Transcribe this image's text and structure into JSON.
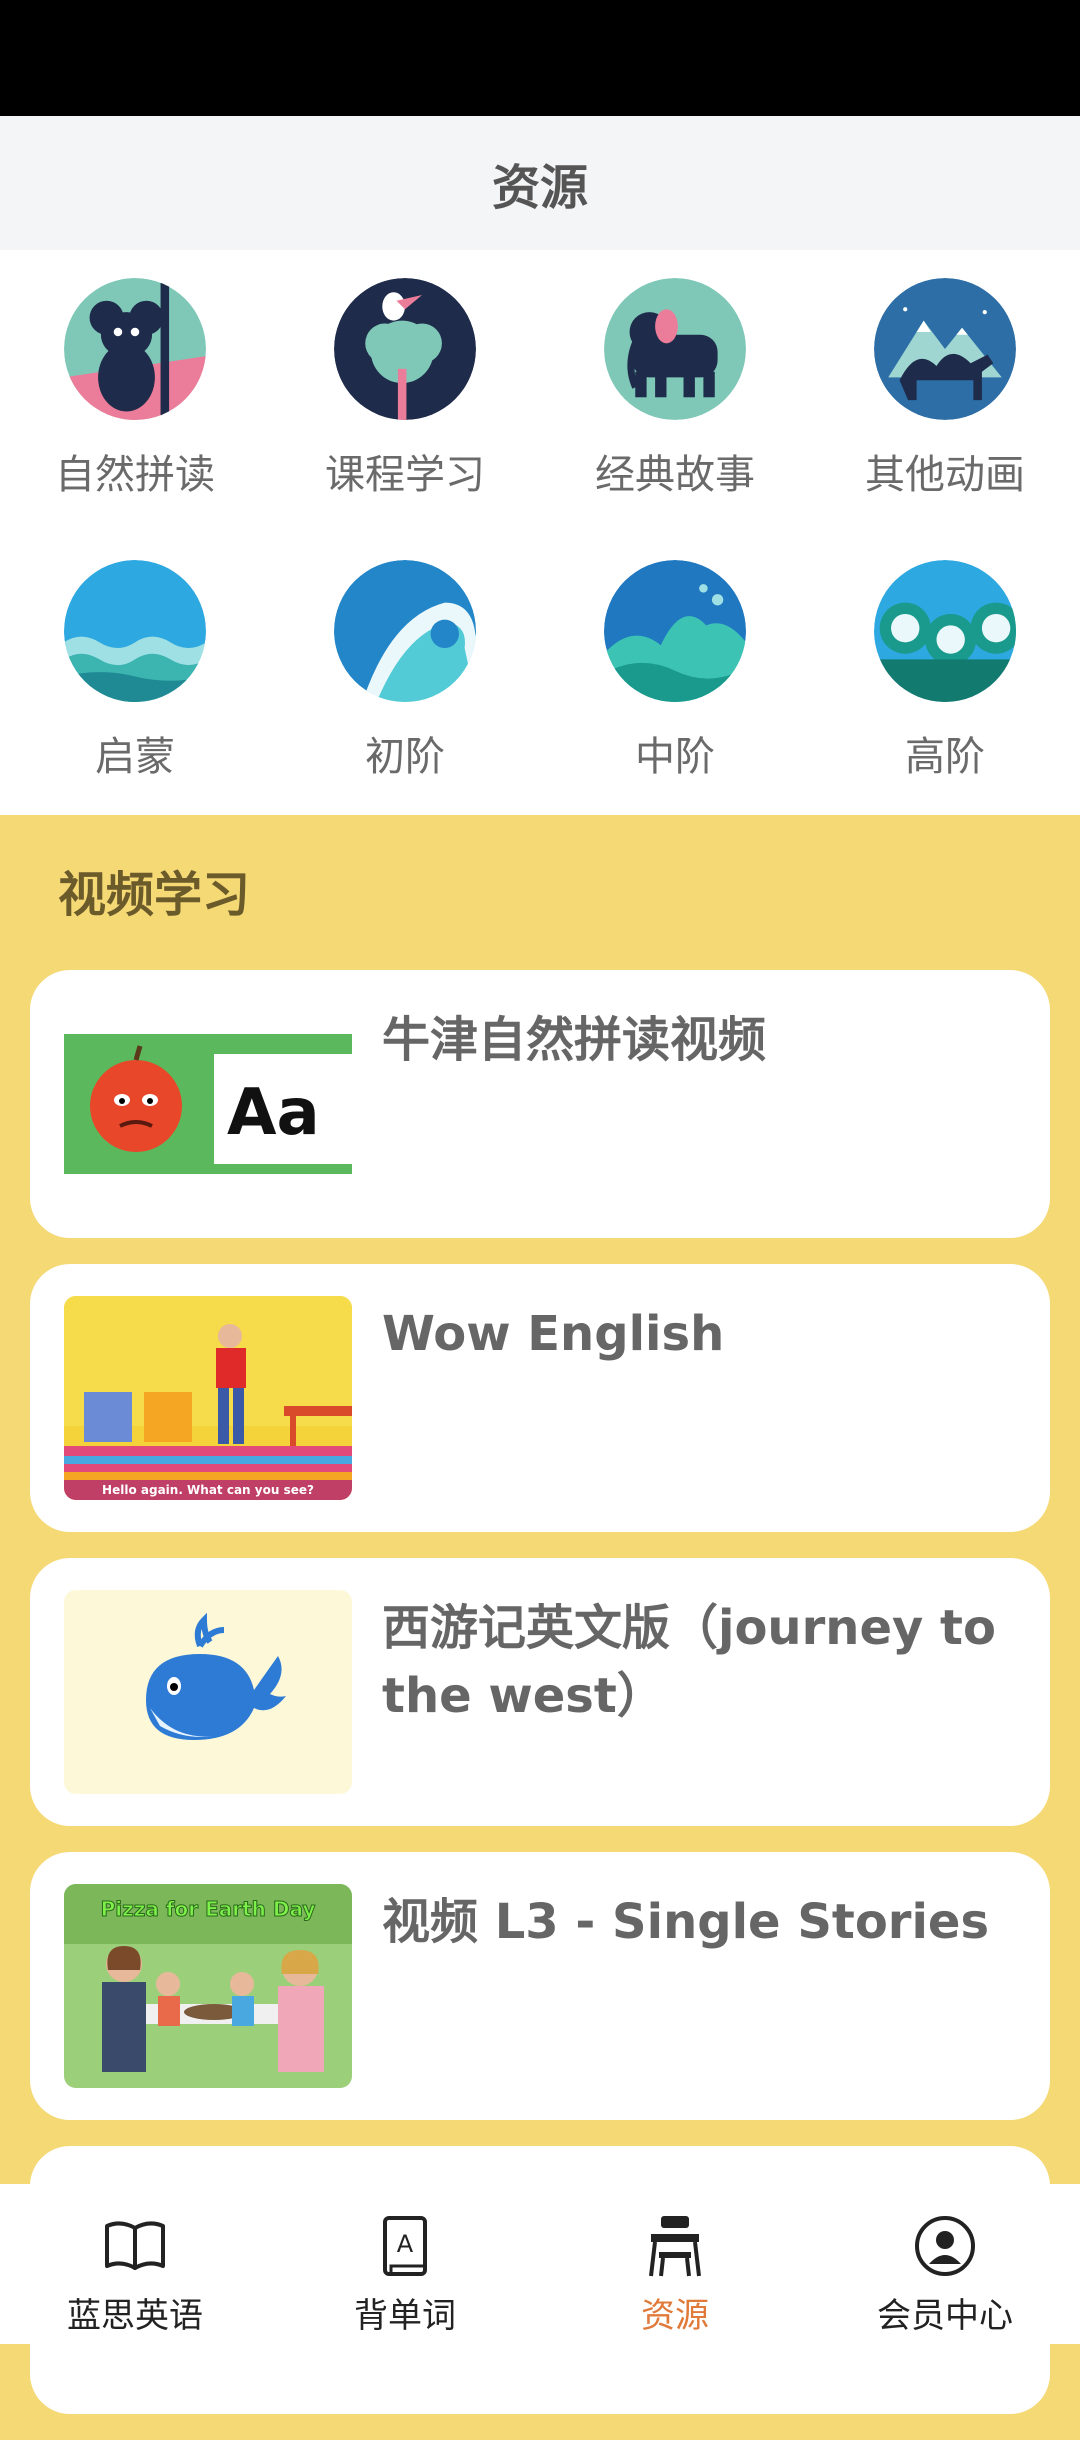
{
  "header": {
    "title": "资源"
  },
  "categories": [
    {
      "label": "自然拼读",
      "icon": "koala-icon"
    },
    {
      "label": "课程学习",
      "icon": "toucan-tree-icon"
    },
    {
      "label": "经典故事",
      "icon": "elephant-icon"
    },
    {
      "label": "其他动画",
      "icon": "camel-icon"
    },
    {
      "label": "启蒙",
      "icon": "calm-wave-icon"
    },
    {
      "label": "初阶",
      "icon": "curl-wave-icon"
    },
    {
      "label": "中阶",
      "icon": "splash-wave-icon"
    },
    {
      "label": "高阶",
      "icon": "swirl-wave-icon"
    }
  ],
  "video_section": {
    "title": "视频学习",
    "items": [
      {
        "title": "牛津自然拼读视频",
        "thumb_icon": "apple-aa-thumbnail",
        "thumb_text": "Aa"
      },
      {
        "title": "Wow English",
        "thumb_icon": "teacher-classroom-thumbnail",
        "thumb_caption": "Hello again. What can you see?"
      },
      {
        "title": "西游记英文版（journey to the west）",
        "thumb_icon": "whale-thumbnail"
      },
      {
        "title": "视频 L3 - Single Stories",
        "thumb_icon": "family-picnic-thumbnail",
        "thumb_caption": "Pizza for Earth Day"
      }
    ]
  },
  "tabbar": {
    "tabs": [
      {
        "label": "蓝思英语",
        "icon": "book-icon"
      },
      {
        "label": "背单词",
        "icon": "word-book-icon"
      },
      {
        "label": "资源",
        "icon": "desk-icon",
        "active": true
      },
      {
        "label": "会员中心",
        "icon": "user-circle-icon"
      }
    ]
  },
  "colors": {
    "accent": "#e07a3a",
    "section_bg": "#f5d975",
    "card_bg": "#ffffff"
  }
}
